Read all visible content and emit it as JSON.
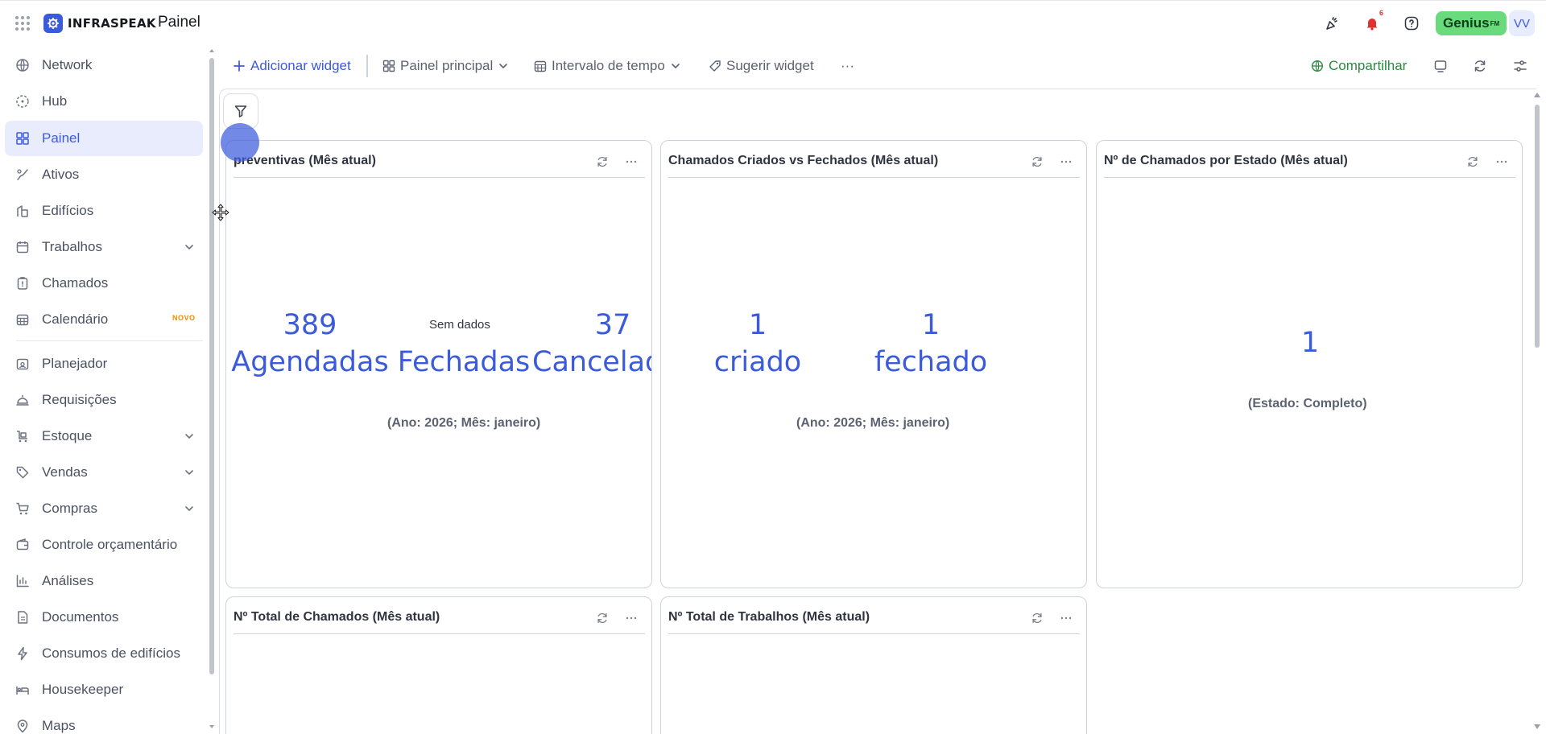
{
  "app": {
    "brand": "INFRASPEAK",
    "title": "Painel",
    "genius": "Genius",
    "genius_sup": "FM",
    "avatar": "VV",
    "notifications_count": "6"
  },
  "sidebar": {
    "items": [
      {
        "label": "Network",
        "icon": "globe-icon"
      },
      {
        "label": "Hub",
        "icon": "hub-icon"
      },
      {
        "label": "Painel",
        "icon": "dashboard-icon",
        "active": true
      },
      {
        "label": "Ativos",
        "icon": "assets-icon"
      },
      {
        "label": "Edifícios",
        "icon": "building-icon"
      },
      {
        "label": "Trabalhos",
        "icon": "calendar-icon",
        "expandable": true
      },
      {
        "label": "Chamados",
        "icon": "clipboard-icon"
      },
      {
        "label": "Calendário",
        "icon": "calendar-grid-icon",
        "badge": "NOVO"
      },
      {
        "label": "Planejador",
        "icon": "planner-icon"
      },
      {
        "label": "Requisições",
        "icon": "bell-desk-icon"
      },
      {
        "label": "Estoque",
        "icon": "stock-icon",
        "expandable": true
      },
      {
        "label": "Vendas",
        "icon": "tag-icon",
        "expandable": true
      },
      {
        "label": "Compras",
        "icon": "cart-icon",
        "expandable": true
      },
      {
        "label": "Controle orçamentário",
        "icon": "wallet-icon"
      },
      {
        "label": "Análises",
        "icon": "bar-chart-icon"
      },
      {
        "label": "Documentos",
        "icon": "document-icon"
      },
      {
        "label": "Consumos de edifícios",
        "icon": "lightning-icon"
      },
      {
        "label": "Housekeeper",
        "icon": "bed-icon"
      },
      {
        "label": "Maps",
        "icon": "map-pin-icon"
      }
    ]
  },
  "toolbar": {
    "add_widget": "Adicionar widget",
    "main_panel": "Painel principal",
    "time_range": "Intervalo de tempo",
    "suggest_widget": "Sugerir widget",
    "more": "···",
    "share": "Compartilhar"
  },
  "cards": {
    "c1": {
      "title": "preventivas (Mês atual)",
      "k1_value": "389",
      "k1_label": "Agendadas",
      "k2_label": "Fechadas",
      "k2_nodata": "Sem dados",
      "k3_value": "37",
      "k3_label": "Cancelad",
      "caption": "(Ano: 2026; Mês: janeiro)"
    },
    "c2": {
      "title": "Chamados Criados vs Fechados (Mês atual)",
      "k1_value": "1",
      "k1_label": "criado",
      "k2_value": "1",
      "k2_label": "fechado",
      "caption": "(Ano: 2026; Mês: janeiro)"
    },
    "c3": {
      "title": "Nº de Chamados por Estado (Mês atual)",
      "k1_value": "1",
      "caption": "(Estado: Completo)"
    },
    "c4": {
      "title": "Nº Total de Chamados (Mês atual)"
    },
    "c5": {
      "title": "Nº Total de Trabalhos (Mês atual)"
    }
  },
  "colors": {
    "accent": "#3b5bdb",
    "share": "#2b8a3e",
    "genius_bg": "#69db7c",
    "badge": "#e03131"
  }
}
